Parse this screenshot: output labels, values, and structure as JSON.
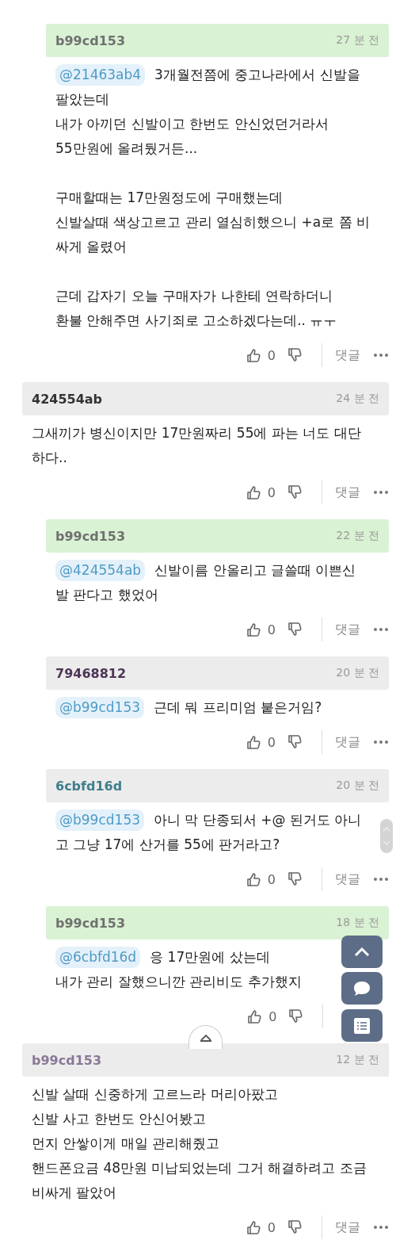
{
  "comments": [
    {
      "kind": "reply",
      "highlighted": true,
      "author": "b99cd153",
      "color": "#707070",
      "time": "27 분 전",
      "mention": "@21463ab4",
      "paragraphs": [
        [
          "3개월전쯤에 중고나라에서 신발을",
          "팔았는데",
          "내가 아끼던 신발이고 한번도 안신었던거라서",
          "55만원에 올려뒀거든..."
        ],
        [
          "구매할때는 17만원정도에 구매했는데",
          "신발살때 색상고르고 관리 열심히했으니 +a로 쫌 비",
          "싸게 올렸어"
        ],
        [
          "근데 갑자기 오늘 구매자가 나한테 연락하더니",
          "환불 안해주면 사기죄로 고소하겠다는데.. ㅠㅜ"
        ]
      ],
      "likes": "0",
      "reply_label": "댓글"
    },
    {
      "kind": "comment",
      "highlighted": false,
      "author": "424554ab",
      "color": "#333333",
      "time": "24 분 전",
      "paragraphs": [
        [
          "그새끼가 병신이지만 17만원짜리 55에 파는 너도 대단",
          "하다.."
        ]
      ],
      "likes": "0",
      "reply_label": "댓글"
    },
    {
      "kind": "reply",
      "highlighted": true,
      "author": "b99cd153",
      "color": "#707070",
      "time": "22 분 전",
      "mention": "@424554ab",
      "paragraphs": [
        [
          "신발이름 안올리고 글쓸때 이쁜신",
          "발 판다고 했었어"
        ]
      ],
      "likes": "0",
      "reply_label": "댓글"
    },
    {
      "kind": "reply",
      "highlighted": false,
      "author": "79468812",
      "color": "#4e3557",
      "time": "20 분 전",
      "mention": "@b99cd153",
      "paragraphs": [
        [
          "근데 뭐 프리미엄 붙은거임?"
        ]
      ],
      "likes": "0",
      "reply_label": "댓글"
    },
    {
      "kind": "reply",
      "highlighted": false,
      "author": "6cbfd16d",
      "color": "#3f7f8c",
      "time": "20 분 전",
      "mention": "@b99cd153",
      "paragraphs": [
        [
          "아니 막 단종되서 +@ 된거도 아니",
          "고 그냥 17에 산거를 55에 판거라고?"
        ]
      ],
      "likes": "0",
      "reply_label": "댓글"
    },
    {
      "kind": "reply",
      "highlighted": true,
      "author": "b99cd153",
      "color": "#707070",
      "time": "18 분 전",
      "mention": "@6cbfd16d",
      "paragraphs": [
        [
          "응 17만원에 샀는데",
          "내가 관리 잘했으니깐 관리비도 추가했지"
        ]
      ],
      "likes": "0"
    },
    {
      "kind": "comment",
      "highlighted": false,
      "author": "b99cd153",
      "color": "#8a7896",
      "time": "12 분 전",
      "paragraphs": [
        [
          "신발 살때 신중하게 고르느라 머리아팠고",
          "신발 사고 한번도 안신어봤고",
          "먼지 안쌓이게 매일 관리해줬고",
          "핸드폰요금 48만원 미납되었는데 그거 해결하려고 조금",
          "비싸게 팔았어"
        ]
      ],
      "likes": "0",
      "reply_label": "댓글"
    }
  ]
}
